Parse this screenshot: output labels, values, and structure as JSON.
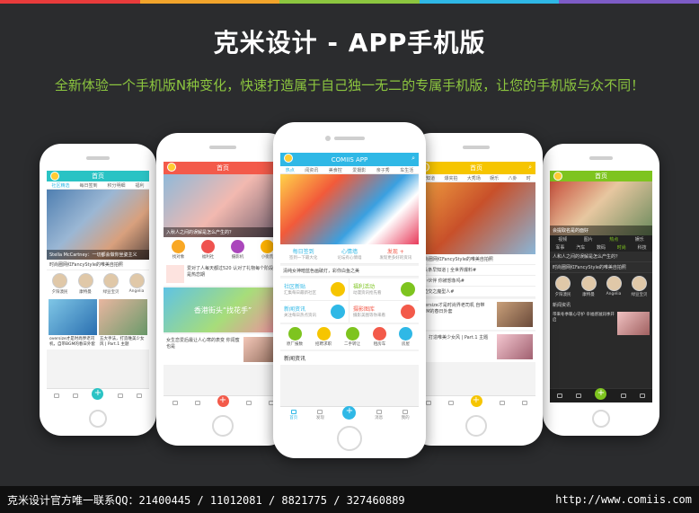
{
  "colors": {
    "stripe": [
      "#e93b3b",
      "#f2a42b",
      "#8cc63f",
      "#2fb8e6",
      "#7d5cc6"
    ],
    "cyan": "#2fb8e6",
    "teal": "#2ac3c4",
    "coral": "#f35a4a",
    "yellow": "#f6c500",
    "green": "#7ec41f",
    "subtitle": "#8cc63f"
  },
  "header": {
    "title": "克米设计 - APP手机版",
    "subtitle": "全新体验一个手机版N种变化，快速打造属于自己独一无二的专属手机版，让您的手机版与众不同！"
  },
  "phone1": {
    "title": "首页",
    "tabs": [
      "社区精选",
      "每日签到",
      "积分明细",
      "福利"
    ],
    "hero_caption": "Stella McCartney：一切都会做你坐姿主义",
    "line1": "时尚圈网红FancyStyle的唯美自拍照",
    "people": [
      "夕阳澳民",
      "康特曼",
      "绿豆宝贝",
      "Angelia"
    ],
    "posts": [
      "oversize才是时尚界老司机，自带BGM的春日外套",
      "五大手法，打造唯美少女风 | Part.1 主题"
    ]
  },
  "phone2": {
    "title": "首页",
    "hero_caption": "入秋人之间的误解是怎么产生的？",
    "icons": [
      "找对象",
      "福利社",
      "摄影机",
      "小街荒"
    ],
    "quote": "爱对了人每天都过520 认对了礼物每个阶段都是热恋期",
    "banner": "香港街头“找花手”",
    "post": "女生恋爱后最让人心寒的表变 你闺蜜也是"
  },
  "phone3": {
    "title": "COMIIS APP",
    "tabs": [
      "热点",
      "阅资讯",
      "美食控",
      "爱摄影",
      "亲子秀",
      "车生活"
    ],
    "stats": [
      {
        "title": "每日签到",
        "sub": "签到一下最大化"
      },
      {
        "title": "心情墙",
        "sub": "论坛有心情墙"
      },
      {
        "title": "发现 +",
        "sub": "发现更多好的资讯"
      }
    ],
    "news_line": "清纯女神暗蓝色画破灯，彩你白鱼之美",
    "features": [
      {
        "title": "社区新贴",
        "sub": "汇集每日最新社区"
      },
      {
        "title": "福利活动",
        "sub": "动漫资讯抢先看"
      },
      {
        "title": "新闻资讯",
        "sub": "关注每日热点资讯"
      },
      {
        "title": "摄影图库",
        "sub": "摄影美图等你来看"
      }
    ],
    "icons": [
      "原厂报数",
      "招聘求职",
      "二手转让",
      "租房车",
      "房屋"
    ],
    "section": "新闻资讯",
    "nav": [
      "首页",
      "发现",
      "",
      "消息",
      "我的"
    ]
  },
  "phone4": {
    "title": "首页",
    "tabs": [
      "早知道",
      "爆夹拍",
      "大秀场",
      "娱乐",
      "八卦",
      "时"
    ],
    "lines": [
      "时尚圈网红FancyStyle的唯美自拍照",
      "#头条早知道 | 全世界爆料#",
      "#小伙伴 你被想象吗#",
      "#边交之魔型人#"
    ],
    "post1": "oversize才是时尚界老司机 自带BGM的春日外套",
    "post2": "法，打造唯美少女风 | Part.1 主题"
  },
  "phone5": {
    "title": "首页",
    "tabs": [
      "视频",
      "图片",
      "热点",
      "娱乐"
    ],
    "tabs2": [
      "军事",
      "汽车",
      "数码",
      "时尚",
      "科技"
    ],
    "hero_caption": "会提取名是的面好",
    "line1": "人和人之间的误解是怎么产生的？",
    "line2": "时尚圈网红FancyStyle的唯美自拍照",
    "people": [
      "夕阳澳民",
      "康特曼",
      "Angelia",
      "绿豆宝贝"
    ],
    "section": "新闻资讯",
    "post": "带来冬季暖心守护 幸福感滋润季开启"
  },
  "footer": {
    "contact": "克米设计官方唯一联系QQ：21400445 / 11012081 / 8821775 / 327460889",
    "url": "http://www.comiis.com"
  }
}
